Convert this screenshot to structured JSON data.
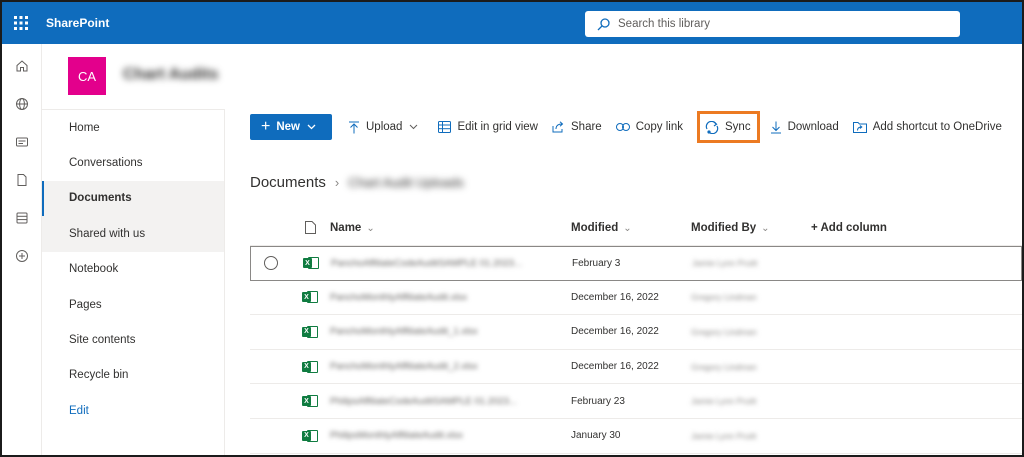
{
  "suite": {
    "app_name": "SharePoint",
    "search_placeholder": "Search this library"
  },
  "rail": {
    "icons": [
      "home-icon",
      "globe-icon",
      "news-icon",
      "file-icon",
      "lists-icon",
      "create-icon"
    ]
  },
  "site": {
    "logo_text": "CA",
    "title": "Chart Audits"
  },
  "nav": {
    "items": [
      {
        "label": "Home"
      },
      {
        "label": "Conversations"
      },
      {
        "label": "Documents"
      },
      {
        "label": "Shared with us"
      },
      {
        "label": "Notebook"
      },
      {
        "label": "Pages"
      },
      {
        "label": "Site contents"
      },
      {
        "label": "Recycle bin"
      },
      {
        "label": "Edit"
      }
    ]
  },
  "commands": {
    "new": "New",
    "upload": "Upload",
    "edit_grid": "Edit in grid view",
    "share": "Share",
    "copy_link": "Copy link",
    "sync": "Sync",
    "download": "Download",
    "add_shortcut": "Add shortcut to OneDrive"
  },
  "breadcrumb": {
    "root": "Documents",
    "folder": "Chart Audit Uploads"
  },
  "columns": {
    "name": "Name",
    "modified": "Modified",
    "modified_by": "Modified By",
    "add_column": "+ Add column"
  },
  "files": [
    {
      "name": "PanchoAffiliateCodeAuditSAMPLE 01.2023...",
      "modified": "February 3",
      "modified_by": "Jamie Lynn Pruitt"
    },
    {
      "name": "PanchoMonthlyAffiliateAudit.xlsx",
      "modified": "December 16, 2022",
      "modified_by": "Gregory Lindman"
    },
    {
      "name": "PanchoMonthlyAffiliateAudit_1.xlsx",
      "modified": "December 16, 2022",
      "modified_by": "Gregory Lindman"
    },
    {
      "name": "PanchoMonthlyAffiliateAudit_2.xlsx",
      "modified": "December 16, 2022",
      "modified_by": "Gregory Lindman"
    },
    {
      "name": "PhilipsAffiliateCodeAuditSAMPLE 01.2023...",
      "modified": "February 23",
      "modified_by": "Jamie Lynn Pruitt"
    },
    {
      "name": "PhilipsMonthlyAffiliateAudit.xlsx",
      "modified": "January 30",
      "modified_by": "Jamie Lynn Pruitt"
    }
  ],
  "colors": {
    "suite_blue": "#0f6cbd",
    "site_logo": "#e3008c",
    "highlight": "#ec7a22",
    "excel_green": "#107c41"
  }
}
